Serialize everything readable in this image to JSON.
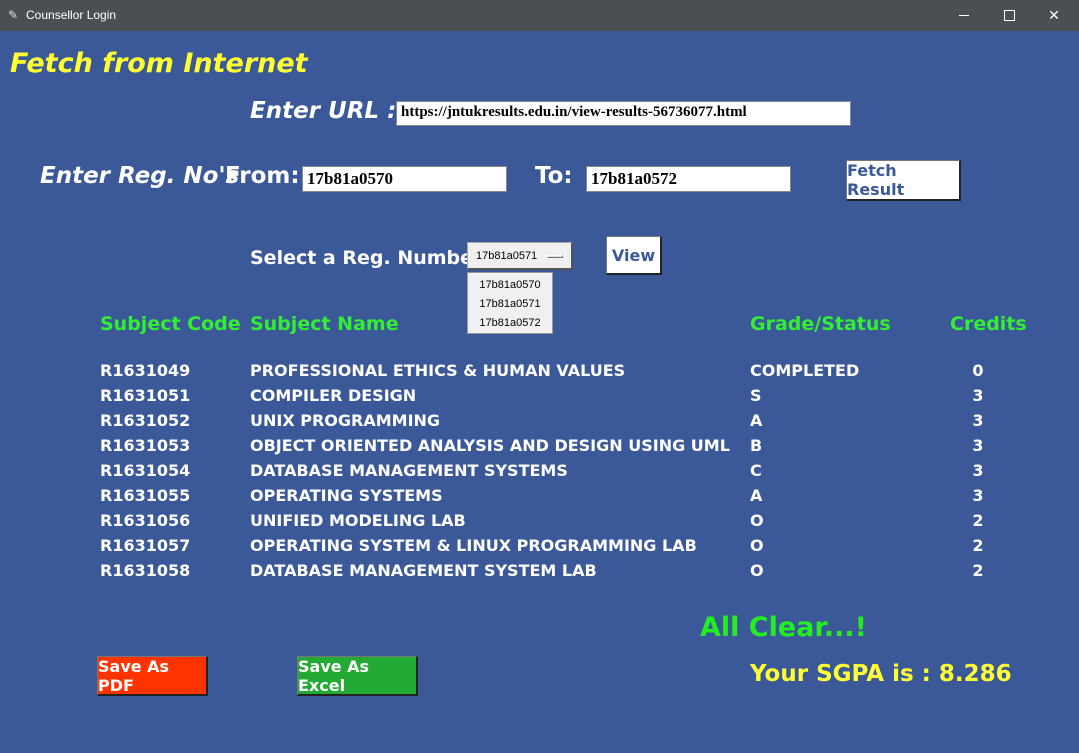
{
  "window": {
    "title": "Counsellor Login",
    "controls": {
      "minimize": "—",
      "maximize": "☐",
      "close": "✕"
    }
  },
  "heading": "Fetch from Internet",
  "url_section": {
    "label": "Enter URL :",
    "value": "https://jntukresults.edu.in/view-results-56736077.html"
  },
  "reg_section": {
    "label": "Enter Reg. No's",
    "from_label": "From:",
    "from_value": "17b81a0570",
    "to_label": "To:",
    "to_value": "17b81a0572",
    "fetch_button": "Fetch Result"
  },
  "select_section": {
    "label": "Select a Reg. Number",
    "selected": "17b81a0571",
    "options": [
      "17b81a0570",
      "17b81a0571",
      "17b81a0572"
    ],
    "view_button": "View"
  },
  "table": {
    "headers": [
      "Subject Code",
      "Subject Name",
      "Grade/Status",
      "Credits"
    ],
    "rows": [
      [
        "R1631049",
        "PROFESSIONAL ETHICS & HUMAN VALUES",
        "COMPLETED",
        "0"
      ],
      [
        "R1631051",
        "COMPILER DESIGN",
        "S",
        "3"
      ],
      [
        "R1631052",
        "UNIX PROGRAMMING",
        "A",
        "3"
      ],
      [
        "R1631053",
        "OBJECT ORIENTED ANALYSIS AND DESIGN USING UML",
        "B",
        "3"
      ],
      [
        "R1631054",
        "DATABASE MANAGEMENT SYSTEMS",
        "C",
        "3"
      ],
      [
        "R1631055",
        "OPERATING SYSTEMS",
        "A",
        "3"
      ],
      [
        "R1631056",
        "UNIFIED MODELING LAB",
        "O",
        "2"
      ],
      [
        "R1631057",
        "OPERATING SYSTEM & LINUX PROGRAMMING LAB",
        "O",
        "2"
      ],
      [
        "R1631058",
        "DATABASE MANAGEMENT SYSTEM LAB",
        "O",
        "2"
      ]
    ]
  },
  "status": "All Clear...!",
  "sgpa": "Your SGPA is : 8.286",
  "buttons": {
    "save_pdf": "Save As PDF",
    "save_excel": "Save As Excel"
  },
  "colors": {
    "background": "#3b5998",
    "heading": "#ffff33",
    "table_header": "#33ee33",
    "status": "#22ee22",
    "pdf_button": "#ff3300",
    "excel_button": "#22aa33"
  }
}
